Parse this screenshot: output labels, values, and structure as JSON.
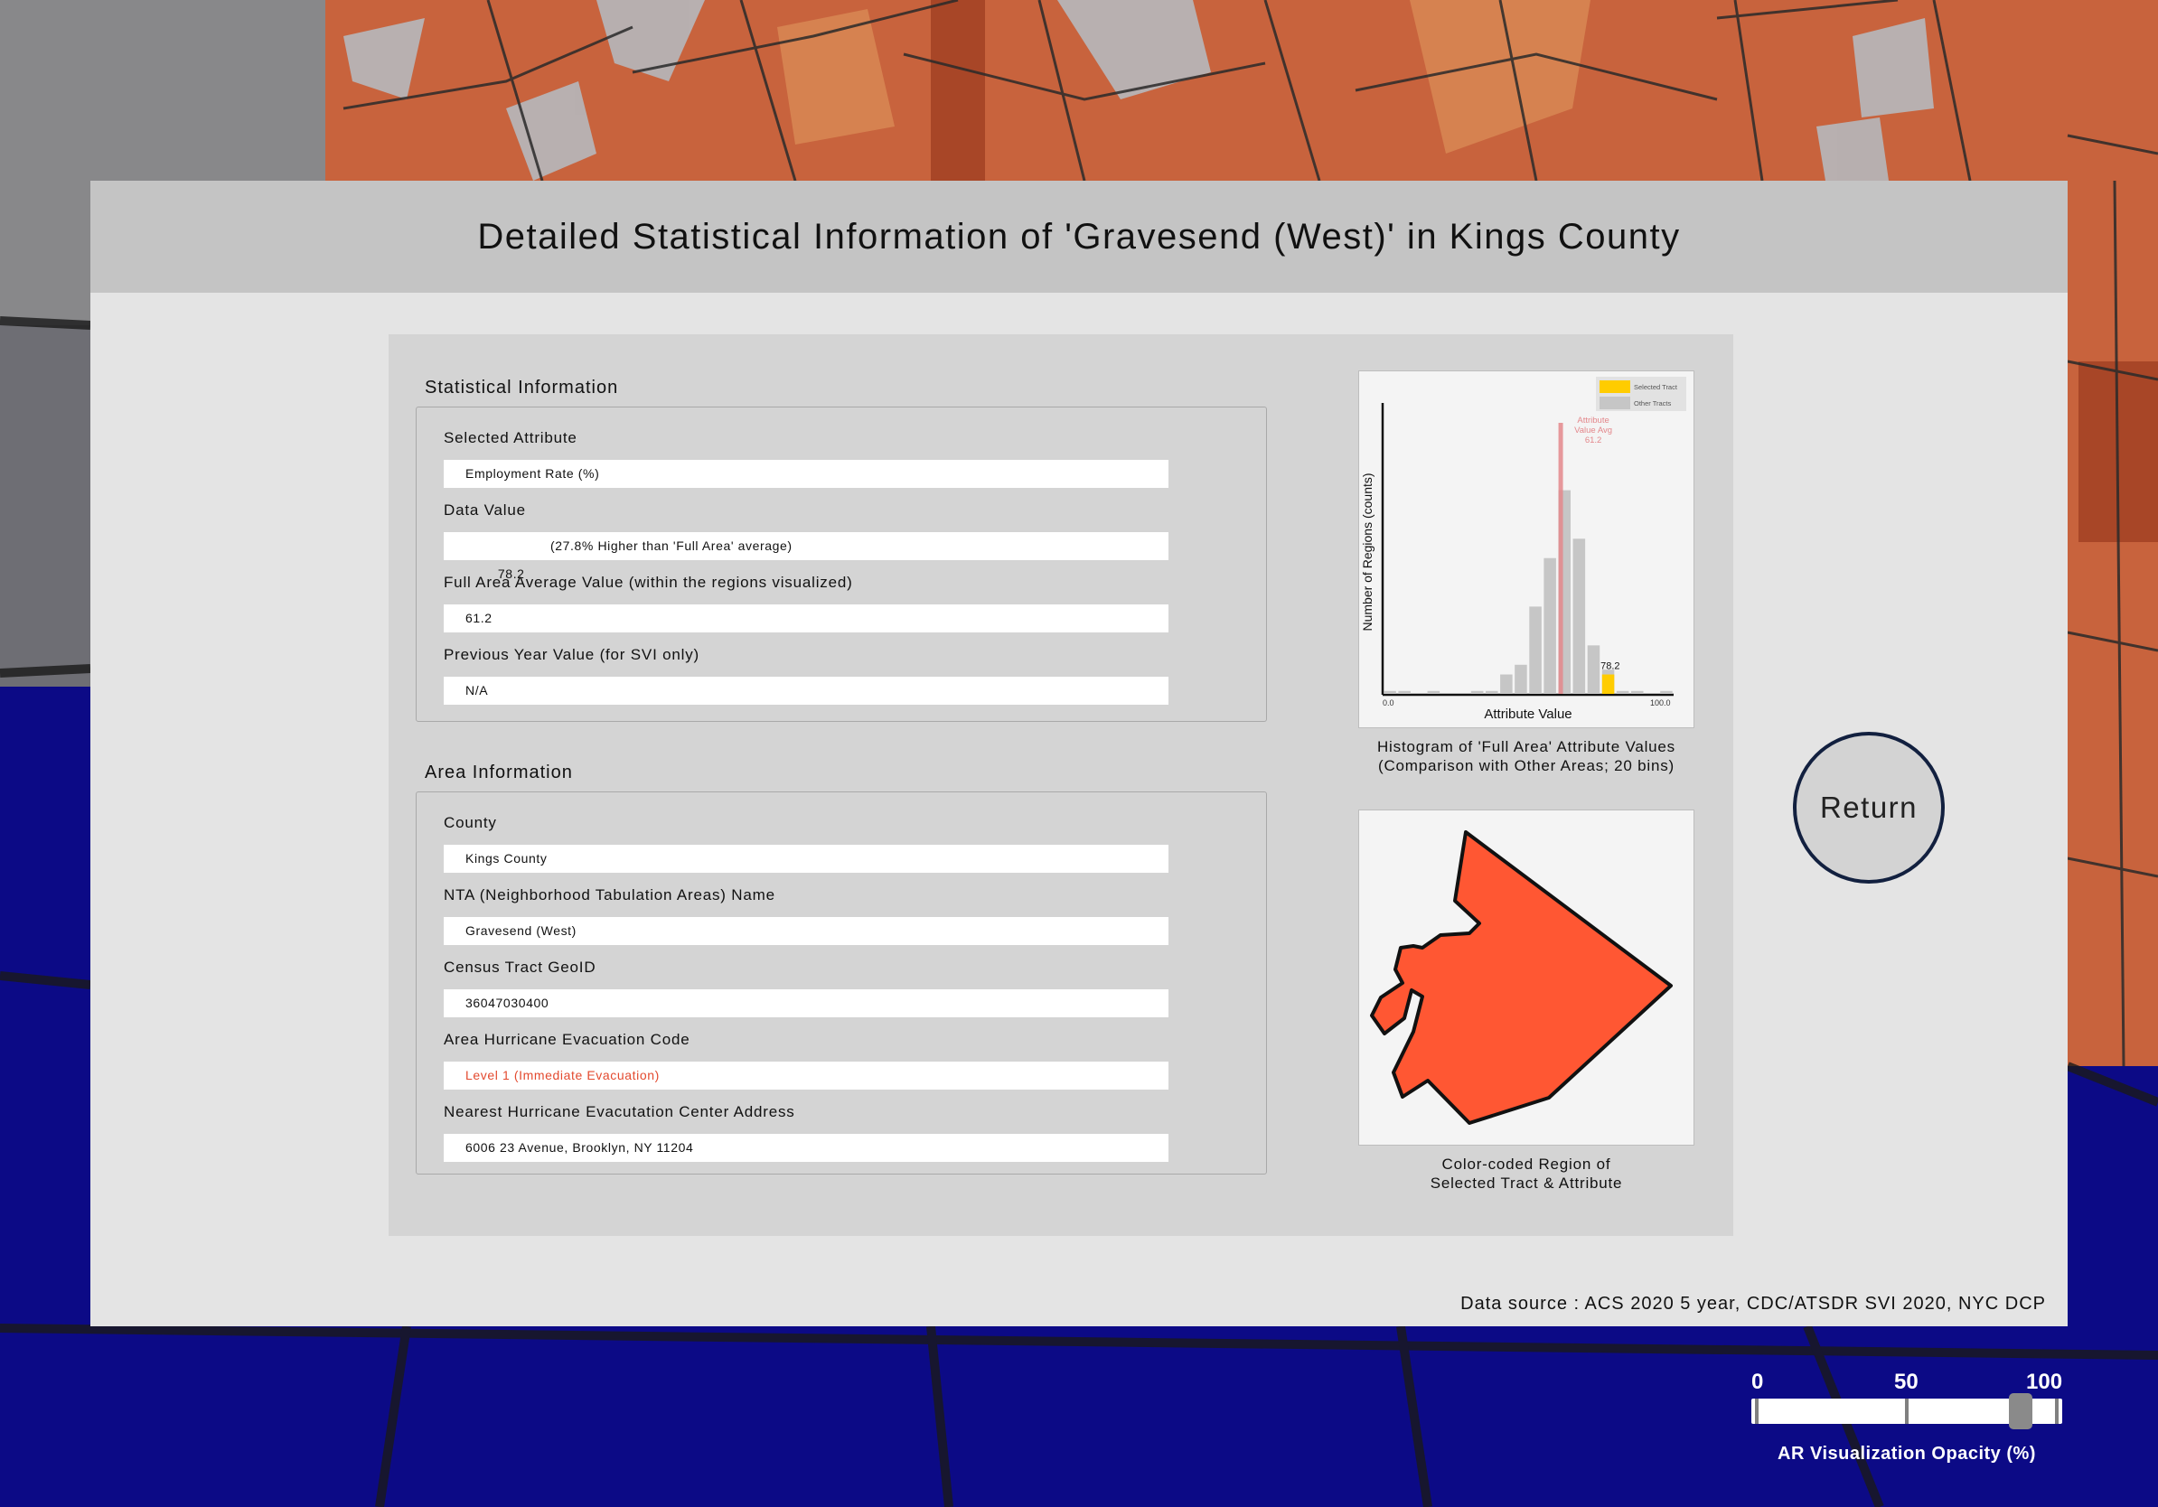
{
  "window_title": "Detailed Statistical Information of 'Gravesend (West)' in Kings County",
  "stats": {
    "section_title": "Statistical Information",
    "selected_attribute_label": "Selected Attribute",
    "selected_attribute_value": "Employment Rate (%)",
    "data_value_label": "Data Value",
    "data_value": "78.2",
    "data_value_diff": "(27.8% Higher than 'Full Area' average)",
    "avg_label": "Full Area Average Value (within the regions visualized)",
    "avg_value": "61.2",
    "prev_label": "Previous Year Value (for SVI only)",
    "prev_value": "N/A"
  },
  "area": {
    "section_title": "Area Information",
    "county_label": "County",
    "county_value": "Kings County",
    "nta_label": "NTA (Neighborhood Tabulation Areas) Name",
    "nta_value": "Gravesend (West)",
    "geoid_label": "Census Tract GeoID",
    "geoid_value": "36047030400",
    "evac_label": "Area Hurricane Evacuation Code",
    "evac_value": "Level 1 (Immediate Evacuation)",
    "center_label": "Nearest Hurricane Evacutation Center Address",
    "center_value": "6006 23 Avenue, Brooklyn, NY 11204"
  },
  "chart_data": {
    "type": "bar",
    "title": "",
    "xlabel": "Attribute Value",
    "ylabel": "Number of Regions (counts)",
    "xlim": [
      0,
      100
    ],
    "bins": 20,
    "x_tick_labels": [
      "0.0",
      "100.0"
    ],
    "legend": {
      "placement": "top-right",
      "entries": [
        "Selected Tract",
        "Other Tracts"
      ]
    },
    "avg_line": {
      "value": 61.2,
      "label": [
        "Attribute",
        "Value Avg",
        "61.2"
      ],
      "color": "#e3878b"
    },
    "selected": {
      "value": 78.2,
      "label": "78.2",
      "color": "#ffcc00"
    },
    "series": [
      {
        "name": "Other Tracts",
        "bin_centers": [
          2.5,
          7.5,
          17.5,
          32.5,
          37.5,
          42.5,
          47.5,
          52.5,
          57.5,
          62.5,
          67.5,
          72.5,
          77.5,
          82.5,
          87.5,
          97.5
        ],
        "values": [
          0.3,
          0.3,
          0.3,
          0.3,
          0.3,
          2,
          3,
          9,
          14,
          21,
          16,
          5,
          2.5,
          0.3,
          0.3,
          0.3
        ],
        "color": "#c6c6c6"
      },
      {
        "name": "Selected Tract",
        "bin_centers": [
          77.5
        ],
        "values": [
          2
        ],
        "color": "#ffcc00"
      }
    ],
    "caption_lines": [
      "Histogram of 'Full Area' Attribute Values",
      "(Comparison with Other Areas; 20 bins)"
    ]
  },
  "map": {
    "caption_lines": [
      "Color-coded Region of",
      "Selected Tract & Attribute"
    ],
    "fill_color": "#ff5733"
  },
  "return_label": "Return",
  "source": "Data source : ACS 2020 5 year, CDC/ATSDR SVI 2020, NYC DCP",
  "opacity_slider": {
    "ticks": [
      "0",
      "50",
      "100"
    ],
    "value": 88,
    "label": "AR Visualization Opacity (%)"
  }
}
